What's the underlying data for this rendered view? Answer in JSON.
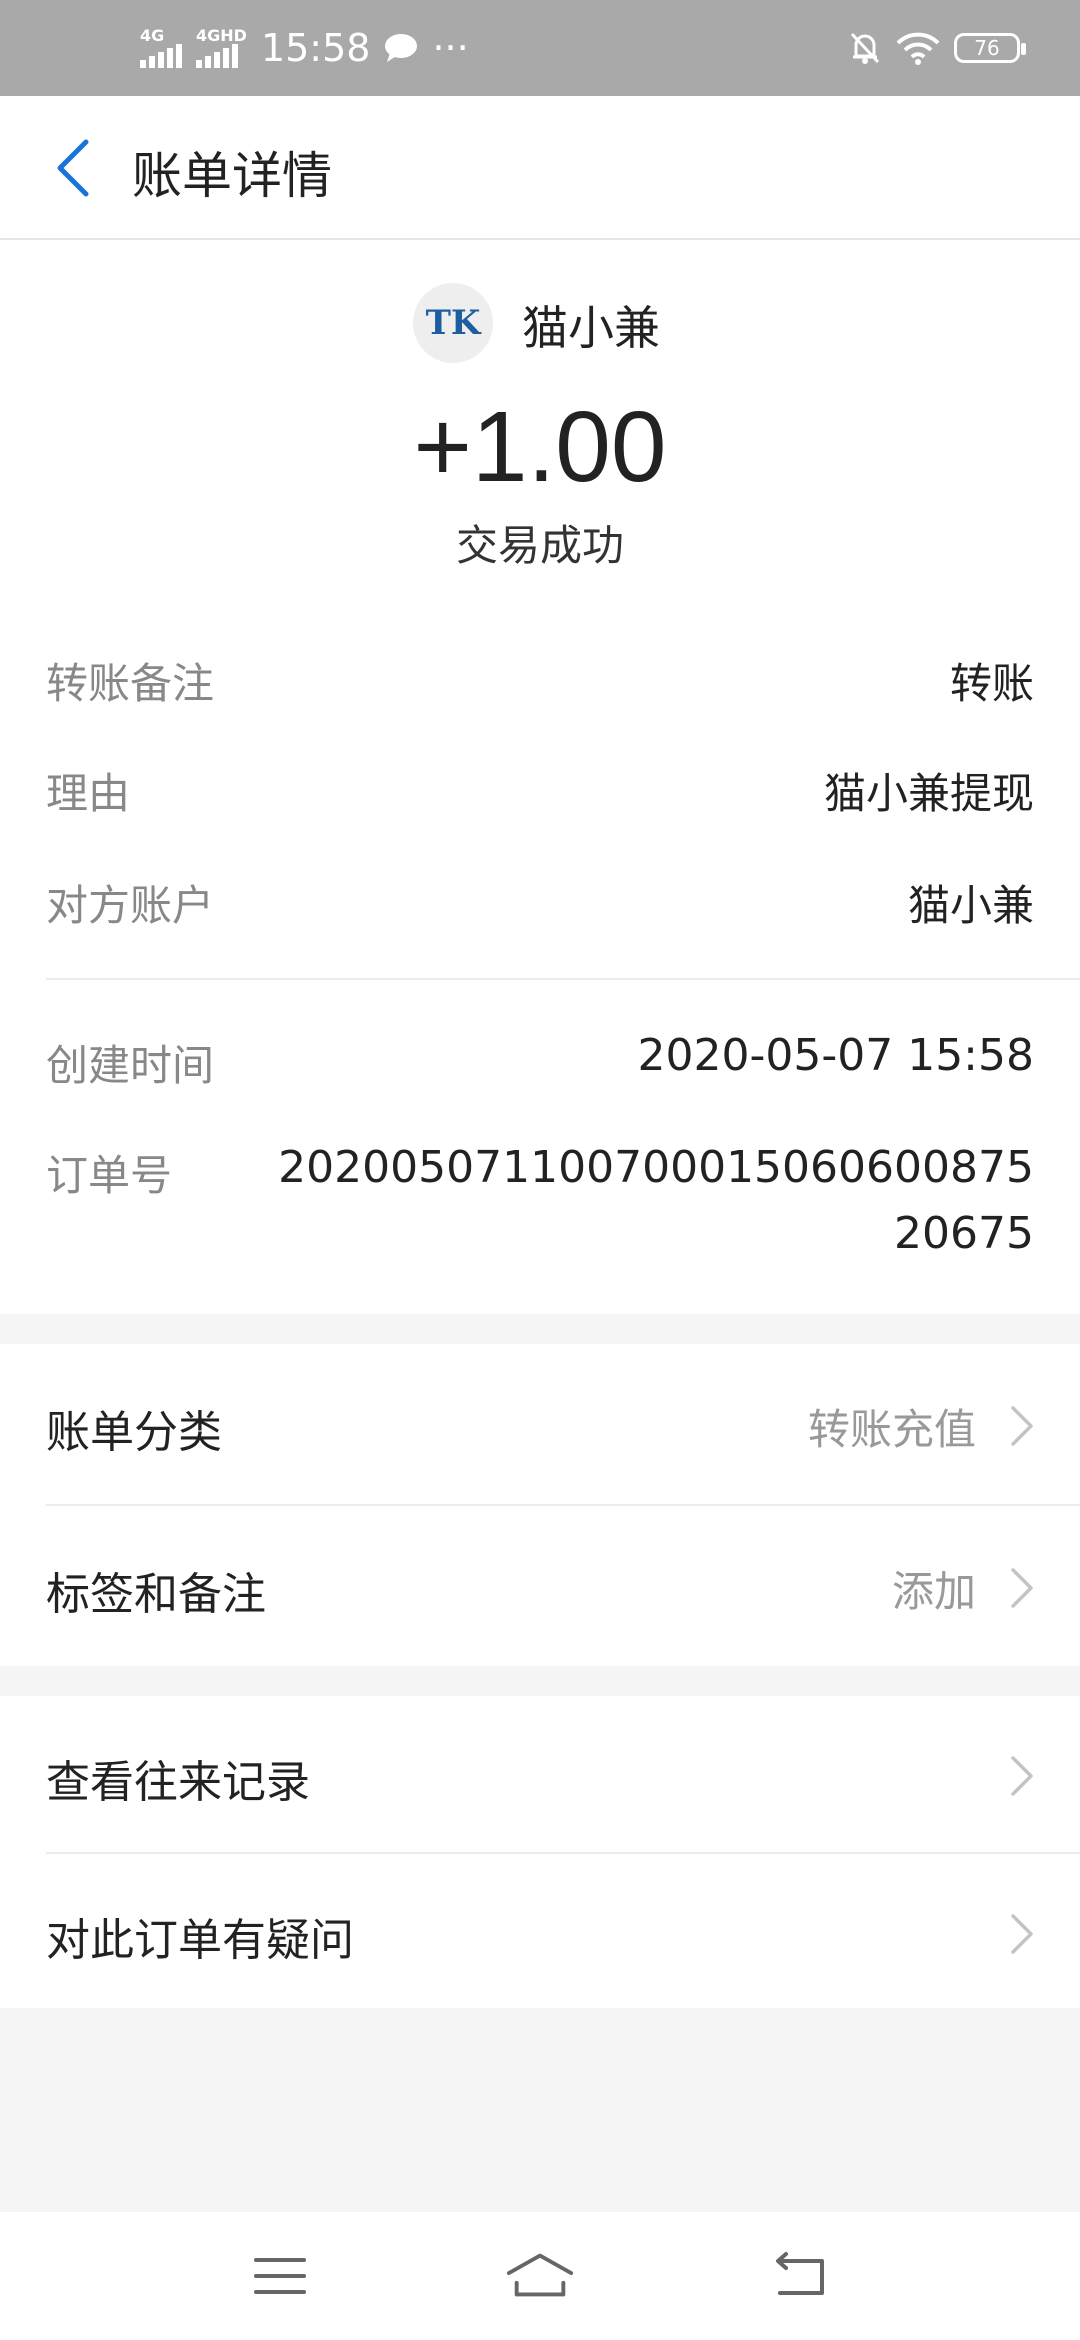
{
  "status_bar": {
    "network_1": "4G",
    "network_2": "4GHD",
    "time": "15:58",
    "more": "···",
    "battery": "76"
  },
  "app_bar": {
    "title": "账单详情",
    "back_icon": "chevron-left-icon"
  },
  "transaction": {
    "avatar_text": "TK",
    "payee": "猫小兼",
    "amount": "+1.00",
    "status": "交易成功"
  },
  "details": {
    "remark_label": "转账备注",
    "remark_value": "转账",
    "reason_label": "理由",
    "reason_value": "猫小兼提现",
    "account_label": "对方账户",
    "account_value": "猫小兼",
    "created_label": "创建时间",
    "created_value": "2020-05-07 15:58",
    "order_label": "订单号",
    "order_value": "20200507110070001506060087520675"
  },
  "list1": {
    "category_label": "账单分类",
    "category_value": "转账充值",
    "tags_label": "标签和备注",
    "tags_value": "添加"
  },
  "list2": {
    "history_label": "查看往来记录",
    "question_label": "对此订单有疑问"
  },
  "colors": {
    "accent": "#1a73d9",
    "status_bar_bg": "#a9a9a9"
  }
}
